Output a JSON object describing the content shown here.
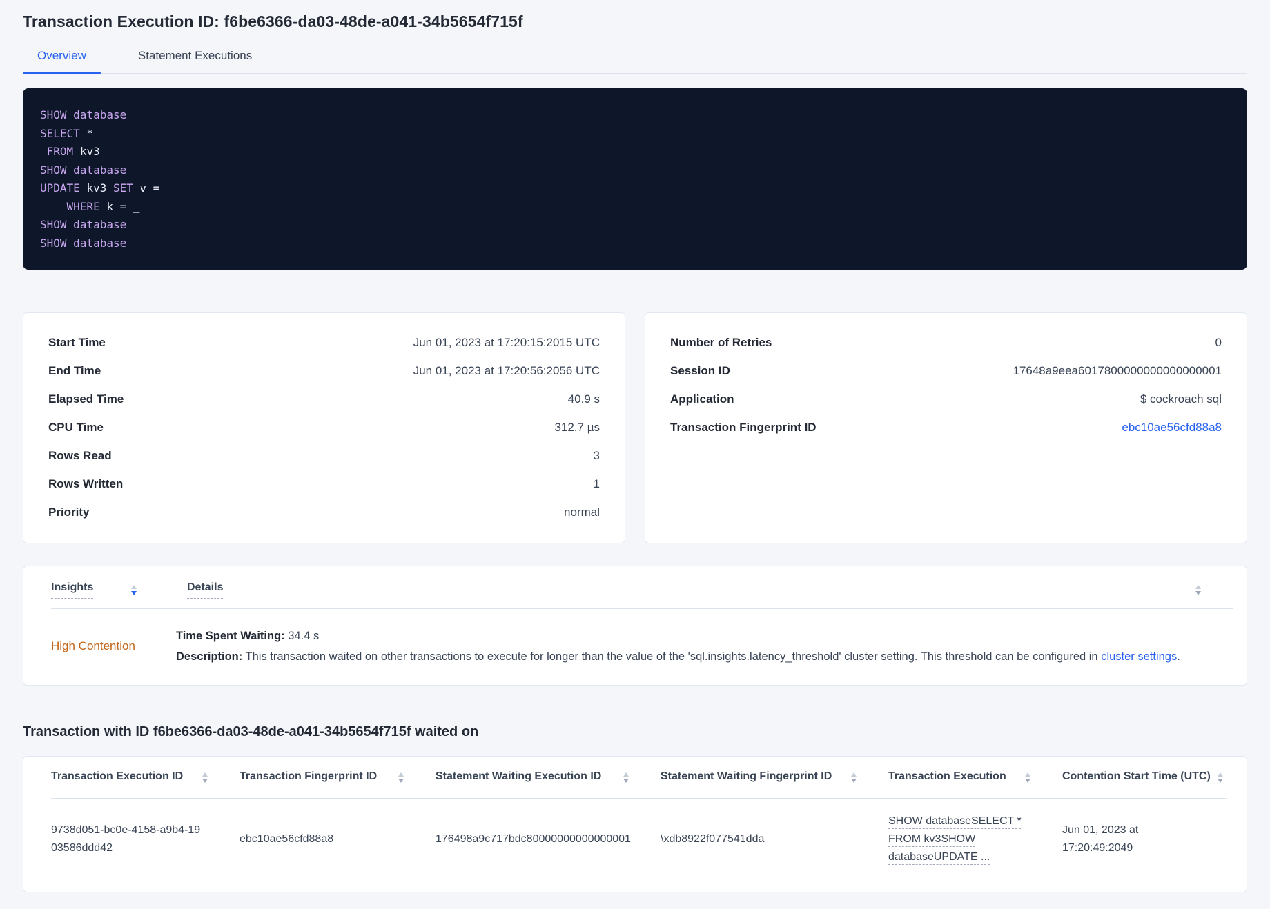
{
  "colors": {
    "accent_blue": "#2962EF",
    "insight_orange": "#C26416",
    "code_background": "#0E1729",
    "code_keyword": "#C9A6F0",
    "code_identifier": "#E9EBF7"
  },
  "header": {
    "title": "Transaction Execution ID: f6be6366-da03-48de-a041-34b5654f715f"
  },
  "tabs": {
    "overview": "Overview",
    "statement_executions": "Statement Executions"
  },
  "sql": {
    "lines": [
      {
        "tokens": [
          {
            "text": "SHOW database",
            "type": "kw"
          }
        ]
      },
      {
        "tokens": [
          {
            "text": "SELECT ",
            "type": "kw"
          },
          {
            "text": "*",
            "type": "id"
          }
        ]
      },
      {
        "tokens": [
          {
            "text": " ",
            "type": "id"
          },
          {
            "text": "FROM ",
            "type": "kw"
          },
          {
            "text": "kv3",
            "type": "id"
          }
        ]
      },
      {
        "tokens": [
          {
            "text": "SHOW database",
            "type": "kw"
          }
        ]
      },
      {
        "tokens": [
          {
            "text": "UPDATE ",
            "type": "kw"
          },
          {
            "text": "kv3 ",
            "type": "id"
          },
          {
            "text": "SET ",
            "type": "kw"
          },
          {
            "text": "v = _",
            "type": "id"
          }
        ]
      },
      {
        "tokens": [
          {
            "text": "    ",
            "type": "id"
          },
          {
            "text": "WHERE ",
            "type": "kw"
          },
          {
            "text": "k = _",
            "type": "id"
          }
        ]
      },
      {
        "tokens": [
          {
            "text": "SHOW database",
            "type": "kw"
          }
        ]
      },
      {
        "tokens": [
          {
            "text": "SHOW database",
            "type": "kw"
          }
        ]
      }
    ]
  },
  "summary_left": {
    "rows": [
      {
        "label": "Start Time",
        "value": "Jun 01, 2023 at 17:20:15:2015 UTC"
      },
      {
        "label": "End Time",
        "value": "Jun 01, 2023 at 17:20:56:2056 UTC"
      },
      {
        "label": "Elapsed Time",
        "value": "40.9 s"
      },
      {
        "label": "CPU Time",
        "value": "312.7 µs"
      },
      {
        "label": "Rows Read",
        "value": "3"
      },
      {
        "label": "Rows Written",
        "value": "1"
      },
      {
        "label": "Priority",
        "value": "normal"
      }
    ]
  },
  "summary_right": {
    "rows": [
      {
        "label": "Number of Retries",
        "value": "0"
      },
      {
        "label": "Session ID",
        "value": "17648a9eea6017800000000000000001"
      },
      {
        "label": "Application",
        "value": "$ cockroach sql"
      },
      {
        "label": "Transaction Fingerprint ID",
        "value": "ebc10ae56cfd88a8"
      }
    ]
  },
  "insights": {
    "columns": {
      "insights": "Insights",
      "details": "Details"
    },
    "row": {
      "insight": "High Contention",
      "waiting_label": "Time Spent Waiting:",
      "waiting_value": " 34.4 s",
      "description_label": "Description:",
      "description_text": " This transaction waited on other transactions to execute for longer than the value of the 'sql.insights.latency_threshold' cluster setting. This threshold can be configured in ",
      "description_link": "cluster settings",
      "description_suffix": "."
    }
  },
  "waited_on": {
    "heading": "Transaction with ID f6be6366-da03-48de-a041-34b5654f715f waited on",
    "columns": [
      "Transaction Execution ID",
      "Transaction Fingerprint ID",
      "Statement Waiting Execution ID",
      "Statement Waiting Fingerprint ID",
      "Transaction Execution",
      "Contention Start Time (UTC)"
    ],
    "row": {
      "transaction_execution_id": "9738d051-bc0e-4158-a9b4-1903586ddd42",
      "transaction_fingerprint_id": "ebc10ae56cfd88a8",
      "statement_waiting_execution_id": "176498a9c717bdc80000000000000001",
      "statement_waiting_fingerprint_id": "\\xdb8922f077541dda",
      "transaction_execution": "SHOW databaseSELECT * FROM kv3SHOW databaseUPDATE ...",
      "contention_start_time": "Jun 01, 2023 at 17:20:49:2049"
    }
  }
}
